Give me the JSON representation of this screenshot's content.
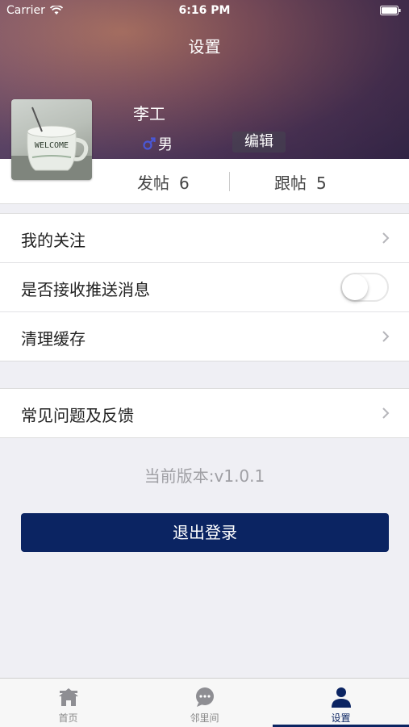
{
  "status_bar": {
    "carrier": "Carrier",
    "time": "6:16 PM"
  },
  "nav": {
    "title": "设置"
  },
  "profile": {
    "name": "李工",
    "gender": "男",
    "edit_label": "编辑",
    "avatar_text": "WELCOME"
  },
  "stats": {
    "posts_label": "发帖",
    "posts_count": "6",
    "replies_label": "跟帖",
    "replies_count": "5"
  },
  "settings": {
    "my_follows": "我的关注",
    "push_label": "是否接收推送消息",
    "push_enabled": false,
    "clear_cache": "清理缓存",
    "faq_feedback": "常见问题及反馈"
  },
  "version_text": "当前版本:v1.0.1",
  "logout_label": "退出登录",
  "tabs": [
    {
      "label": "首页",
      "icon": "home-icon"
    },
    {
      "label": "邻里间",
      "icon": "chat-icon"
    },
    {
      "label": "设置",
      "icon": "person-icon",
      "active": true
    }
  ],
  "colors": {
    "accent": "#0b2462",
    "background": "#efeff4"
  }
}
